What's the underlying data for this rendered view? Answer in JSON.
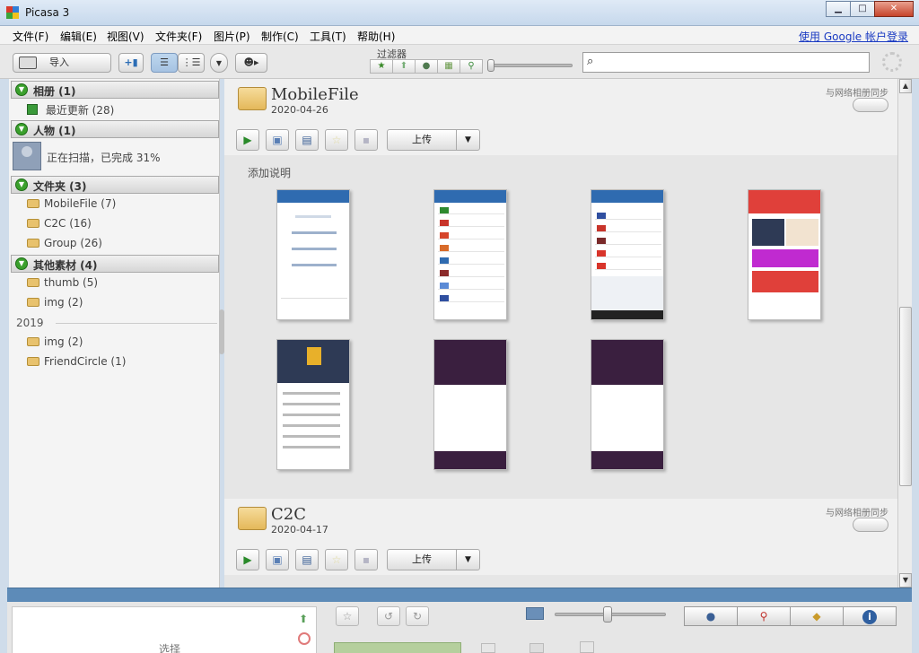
{
  "window": {
    "title": "Picasa 3",
    "minimize": "▁",
    "maximize": "□",
    "close": "✕"
  },
  "menu": {
    "items": [
      "文件(F)",
      "编辑(E)",
      "视图(V)",
      "文件夹(F)",
      "图片(P)",
      "制作(C)",
      "工具(T)",
      "帮助(H)"
    ],
    "signin": "使用 Google 帐户登录"
  },
  "toolbar": {
    "import_label": "导入",
    "filter_label": "过滤器",
    "search_placeholder": ""
  },
  "left": {
    "groups": [
      {
        "label": "相册 (1)"
      },
      {
        "label": "人物 (1)"
      },
      {
        "label": "文件夹 (3)"
      },
      {
        "label": "其他素材 (4)"
      }
    ],
    "recent": "最近更新 (28)",
    "person_status": "正在扫描，已完成 31%",
    "folders": [
      "MobileFile (7)",
      "C2C (16)",
      "Group (26)"
    ],
    "other": [
      "thumb (5)",
      "img (2)"
    ],
    "year": "2019",
    "year_items": [
      "img (2)",
      "FriendCircle (1)"
    ]
  },
  "albums": [
    {
      "title": "MobileFile",
      "date": "2020-04-26",
      "sync": "与网络相册同步",
      "upload": "上传"
    },
    {
      "title": "C2C",
      "date": "2020-04-17",
      "sync": "与网络相册同步",
      "upload": "上传"
    }
  ],
  "main": {
    "add_caption": "添加说明"
  },
  "bottom": {
    "select_label": "选择"
  },
  "colors": {
    "accent_blue": "#5d8bb8",
    "play_green": "#2a8a2a",
    "pin_red": "#c0302a"
  },
  "icons": [
    "import-icon",
    "upload-web-icon",
    "list-view-icon",
    "tree-view-icon",
    "star-filter-icon",
    "upload-filter-icon",
    "people-filter-icon",
    "movie-filter-icon",
    "geo-filter-icon",
    "search-icon",
    "play-icon",
    "collage-icon",
    "movie-icon",
    "star-icon",
    "save-icon",
    "person-icon",
    "map-pin-icon",
    "tag-icon",
    "info-icon"
  ]
}
